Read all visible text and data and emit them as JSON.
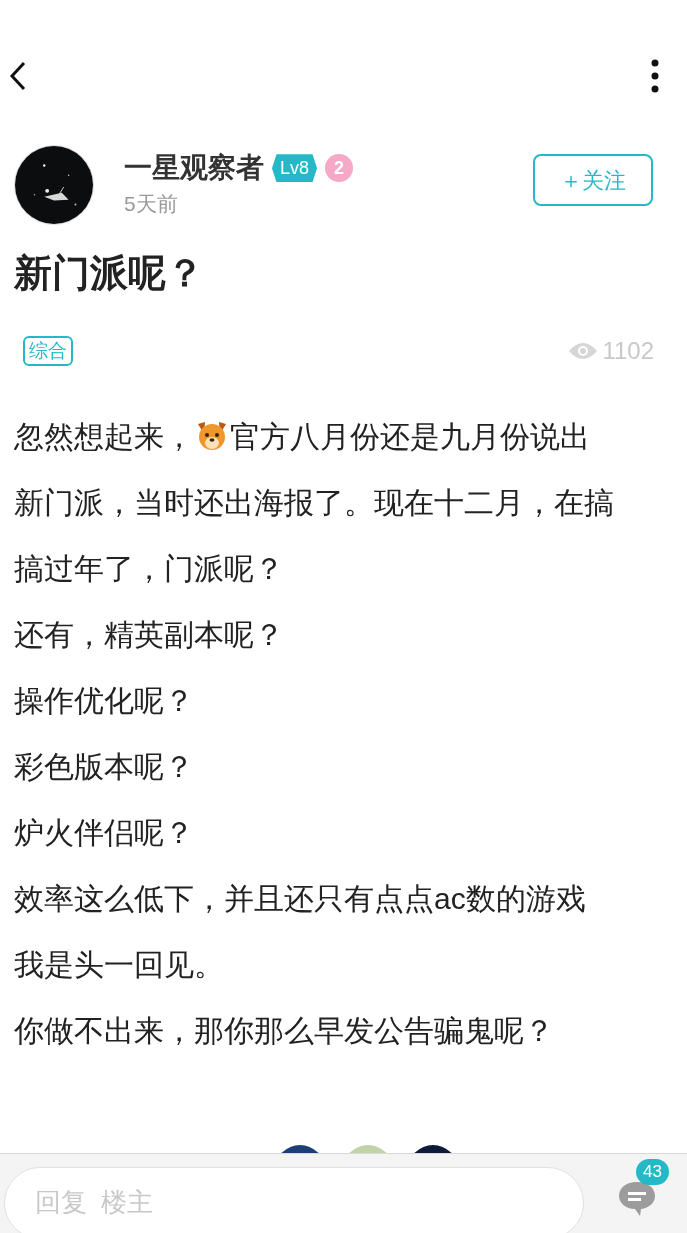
{
  "author": {
    "name": "一星观察者",
    "level": "Lv8",
    "rank": "2",
    "time": "5天前"
  },
  "follow_button": {
    "label": "＋关注"
  },
  "post": {
    "title": "新门派呢？",
    "tag": "综合",
    "views": "1102",
    "lines": [
      {
        "kind": "emoji",
        "before": "忽然想起来，",
        "after": "官方八月份还是九月份说出"
      },
      {
        "kind": "text",
        "text": "新门派，当时还出海报了。现在十二月，在搞"
      },
      {
        "kind": "text",
        "text": "搞过年了，门派呢？"
      },
      {
        "kind": "text",
        "text": "还有，精英副本呢？"
      },
      {
        "kind": "text",
        "text": "操作优化呢？"
      },
      {
        "kind": "text",
        "text": "彩色版本呢？"
      },
      {
        "kind": "text",
        "text": "炉火伴侣呢？"
      },
      {
        "kind": "text",
        "text": "效率这么低下，并且还只有点点ac数的游戏"
      },
      {
        "kind": "text",
        "text": "我是头一回见。"
      },
      {
        "kind": "text",
        "text": "你做不出来，那你那么早发公告骗鬼呢？"
      }
    ]
  },
  "reply_bar": {
    "placeholder": "回复  楼主",
    "comment_count": "43"
  }
}
